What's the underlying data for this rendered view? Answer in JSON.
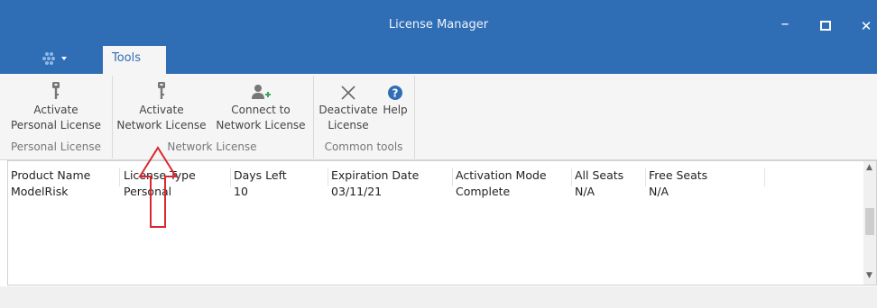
{
  "window": {
    "title": "License Manager",
    "minimize_glyph": "–",
    "close_glyph": "✕"
  },
  "tabs": {
    "app_menu_icon": "app-logo-icon",
    "tools_label": "Tools"
  },
  "ribbon": {
    "buttons": [
      {
        "label_line1": "Activate",
        "label_line2": "Personal License",
        "icon": "key-icon"
      },
      {
        "label_line1": "Activate",
        "label_line2": "Network License",
        "icon": "key-icon"
      },
      {
        "label_line1": "Connect to",
        "label_line2": "Network License",
        "icon": "add-user-icon"
      },
      {
        "label_line1": "Deactivate",
        "label_line2": "License",
        "icon": "x-icon"
      },
      {
        "label_line1": "Help",
        "label_line2": "",
        "icon": "help-icon"
      }
    ],
    "groups": [
      "Personal License",
      "Network License",
      "Common tools"
    ]
  },
  "table": {
    "columns": [
      "Product Name",
      "License Type",
      "Days Left",
      "Expiration Date",
      "Activation Mode",
      "All Seats",
      "Free Seats"
    ],
    "rows": [
      [
        "ModelRisk",
        "Personal",
        "10",
        "03/11/21",
        "Complete",
        "N/A",
        "N/A"
      ]
    ]
  },
  "colors": {
    "title_bar": "#2f6db5",
    "ribbon_bg": "#f5f5f5",
    "annotation_arrow": "#d9282f"
  }
}
